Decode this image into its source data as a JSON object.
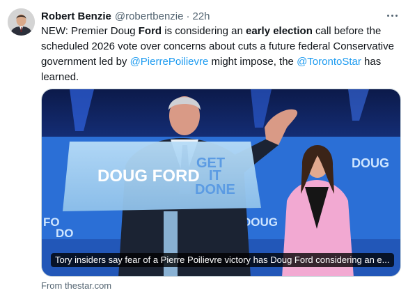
{
  "author": {
    "name": "Robert Benzie",
    "handle": "@robertbenzie",
    "separator": "·",
    "time": "22h"
  },
  "icons": {
    "more": "more-horizontal-icon",
    "avatar": "profile-photo"
  },
  "tweet": {
    "t1": "NEW: Premier Doug ",
    "t2": "Ford",
    "t3": " is considering an ",
    "t4": "early election",
    "t5": " call before the scheduled 2026 vote over concerns about cuts a future federal Conservative government led by ",
    "mention1": "@PierrePoilievre",
    "t6": " might impose, the ",
    "mention2": "@TorontoStar",
    "t7": " has learned."
  },
  "card": {
    "caption": "Tory insiders say fear of a Pierre Poilievre victory has Doug Ford considering an e...",
    "source": "From thestar.com",
    "podium_name": "DOUG FORD",
    "podium_slogan_1": "GET",
    "podium_slogan_2": "IT",
    "podium_slogan_3": "DONE",
    "banner_right": "DOUG",
    "banner_left_1": "FO",
    "banner_left_2": "DO",
    "banner_bottom": "DOUG"
  },
  "colors": {
    "link": "#1d9bf0",
    "muted": "#536471",
    "stage_blue": "#1f4fb8",
    "podium": "#9ccaf0"
  }
}
